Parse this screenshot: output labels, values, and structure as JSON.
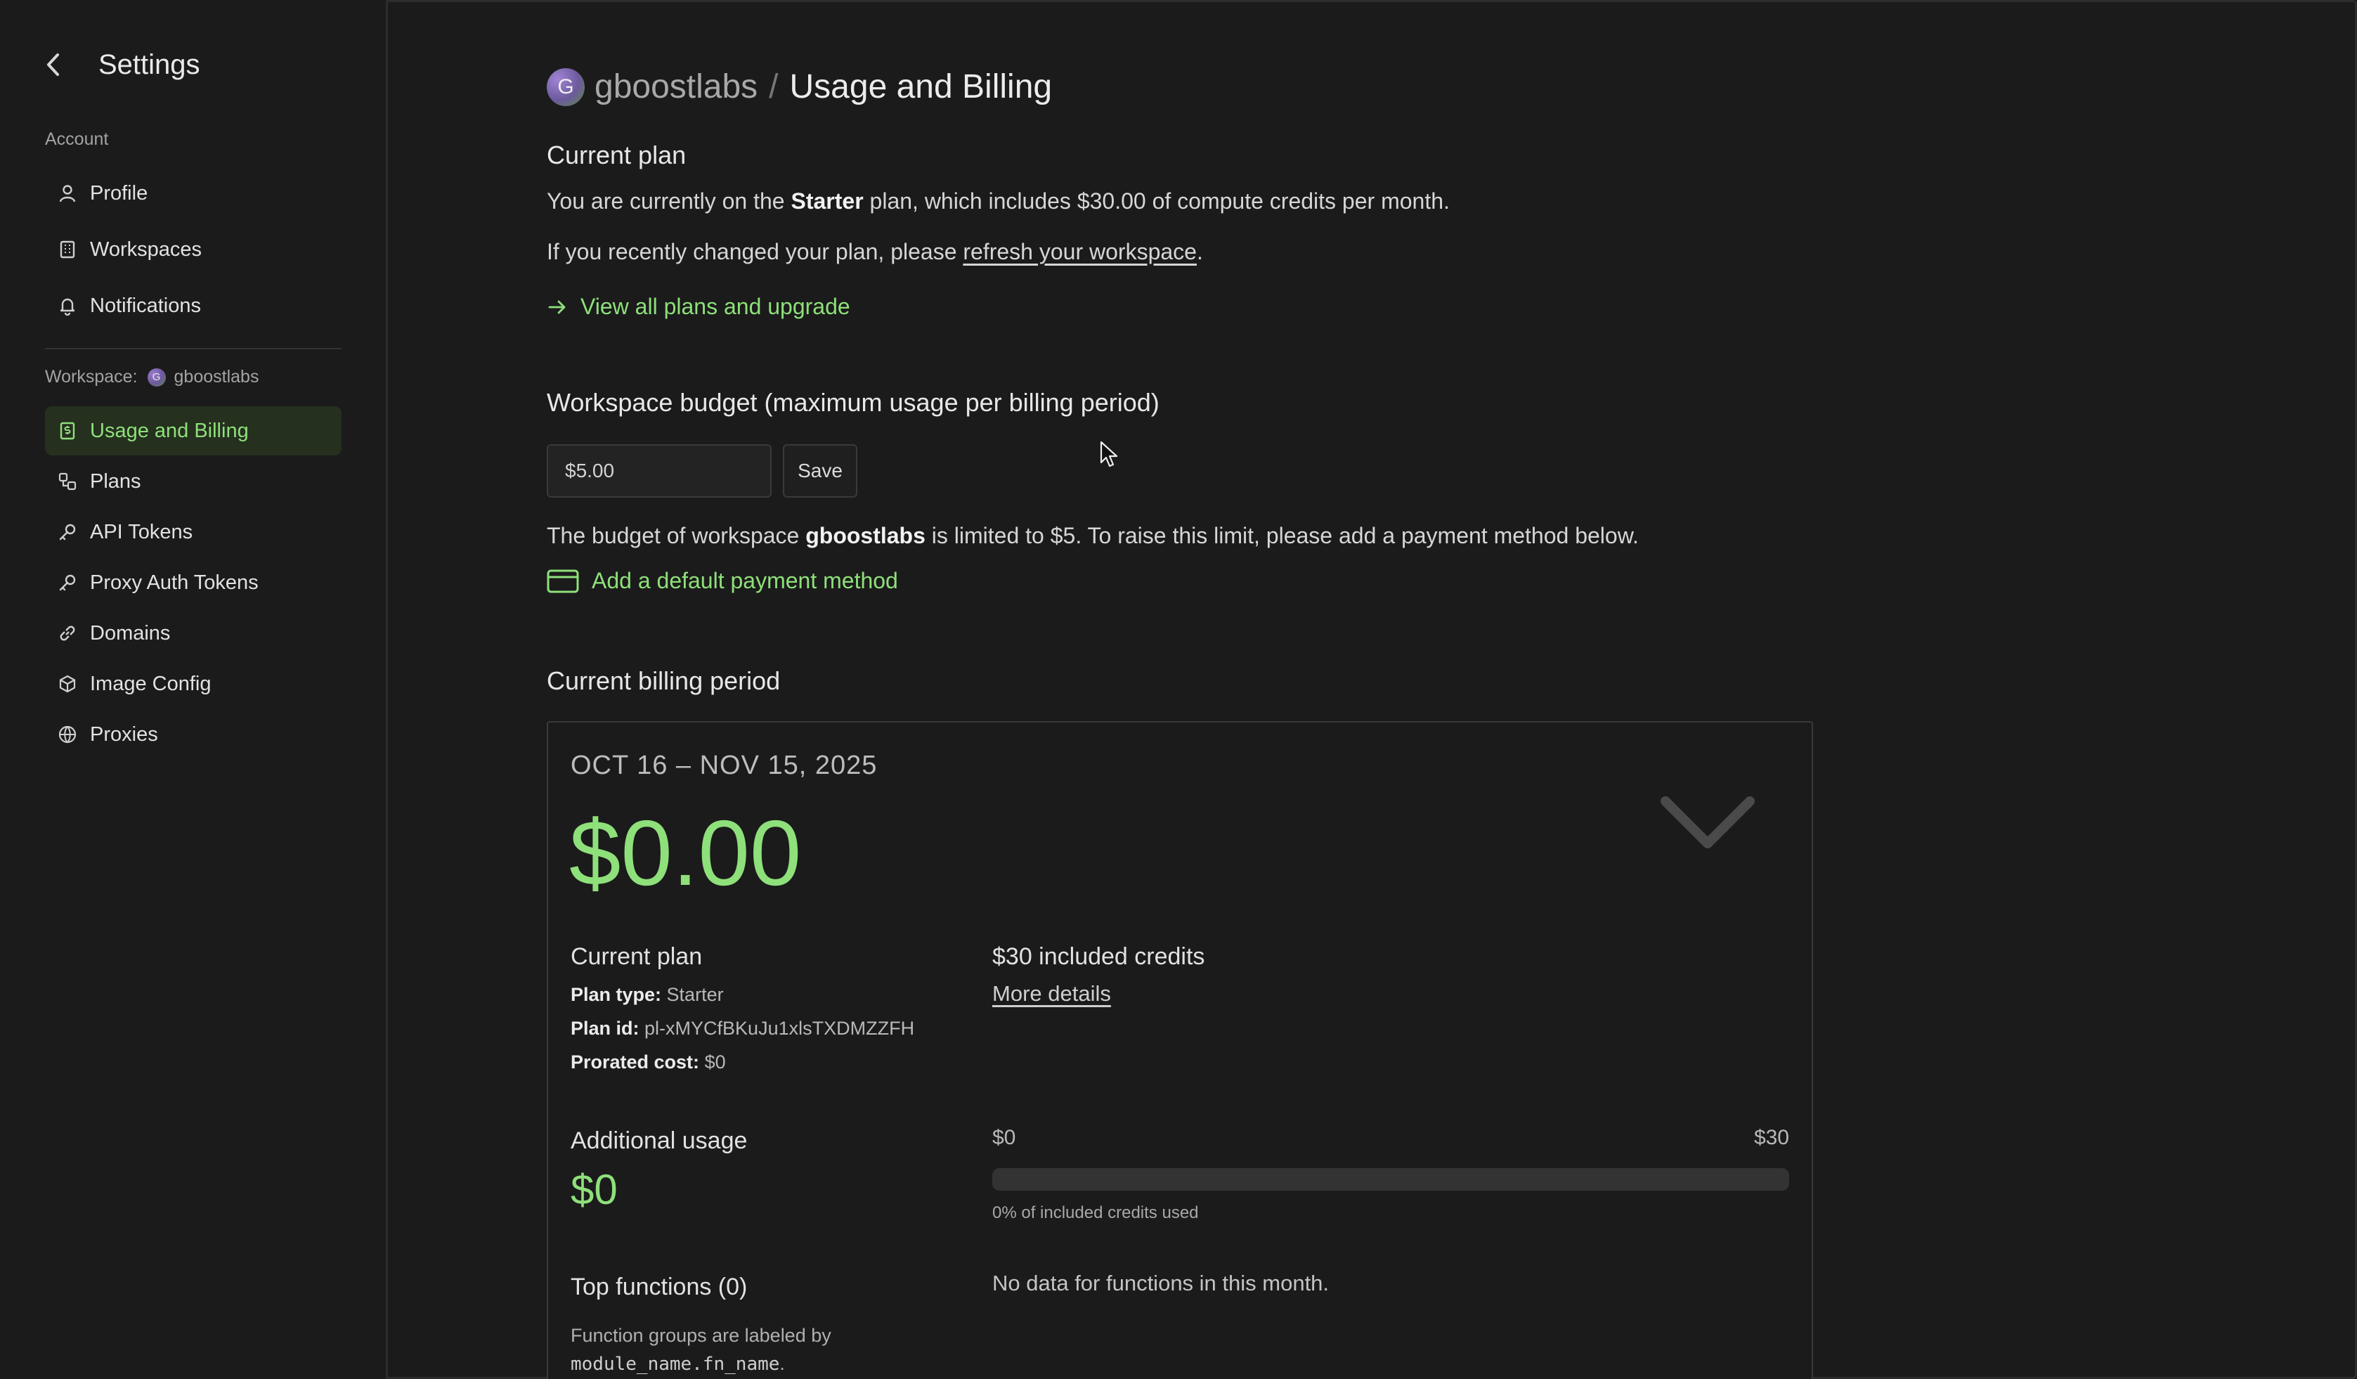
{
  "sidebar": {
    "title": "Settings",
    "account_section": "Account",
    "account_items": [
      {
        "label": "Profile",
        "icon": "user-icon"
      },
      {
        "label": "Workspaces",
        "icon": "building-icon"
      },
      {
        "label": "Notifications",
        "icon": "bell-icon"
      }
    ],
    "workspace_section_label": "Workspace:",
    "workspace_avatar_letter": "G",
    "workspace_name": "gboostlabs",
    "workspace_items": [
      {
        "label": "Usage and Billing",
        "icon": "dollar-receipt-icon",
        "active": true
      },
      {
        "label": "Plans",
        "icon": "plans-icon"
      },
      {
        "label": "API Tokens",
        "icon": "key-icon"
      },
      {
        "label": "Proxy Auth Tokens",
        "icon": "key-icon"
      },
      {
        "label": "Domains",
        "icon": "link-icon"
      },
      {
        "label": "Image Config",
        "icon": "cube-icon"
      },
      {
        "label": "Proxies",
        "icon": "globe-icon"
      }
    ]
  },
  "header": {
    "avatar_letter": "G",
    "workspace": "gboostlabs",
    "separator": "/",
    "page": "Usage and Billing"
  },
  "plan": {
    "heading": "Current plan",
    "line1_pre": "You are currently on the ",
    "line1_plan": "Starter",
    "line1_post": " plan, which includes $30.00 of compute credits per month.",
    "line2_pre": "If you recently changed your plan, please ",
    "line2_link": "refresh your workspace",
    "line2_post": ".",
    "upgrade_link": "View all plans and upgrade"
  },
  "budget": {
    "heading": "Workspace budget (maximum usage per billing period)",
    "input_value": "$5.00",
    "save_label": "Save",
    "note_pre": "The budget of workspace ",
    "note_ws": "gboostlabs",
    "note_post": " is limited to $5. To raise this limit, please add a payment method below.",
    "payment_link": "Add a default payment method"
  },
  "billing": {
    "heading": "Current billing period",
    "period": "OCT 16 – NOV 15, 2025",
    "total": "$0.00",
    "current_plan_heading": "Current plan",
    "plan_type_label": "Plan type:",
    "plan_type": "Starter",
    "plan_id_label": "Plan id:",
    "plan_id": "pl-xMYCfBKuJu1xlsTXDMZZFH",
    "prorated_label": "Prorated cost:",
    "prorated": "$0",
    "credits_heading": "$30 included credits",
    "more_details": "More details",
    "additional_heading": "Additional usage",
    "additional_amount": "$0",
    "bar_min": "$0",
    "bar_max": "$30",
    "credits_used_fraction": 0,
    "credits_used_note": "0% of included credits used",
    "top_functions_heading": "Top functions (0)",
    "no_data": "No data for functions in this month.",
    "fn_note_pre": "Function groups are labeled by",
    "fn_note_code": "module_name.fn_name",
    "fn_note_post": "."
  },
  "colors": {
    "accent": "#8ee07a",
    "background": "#1b1b1b",
    "active_bg": "#25301f"
  }
}
